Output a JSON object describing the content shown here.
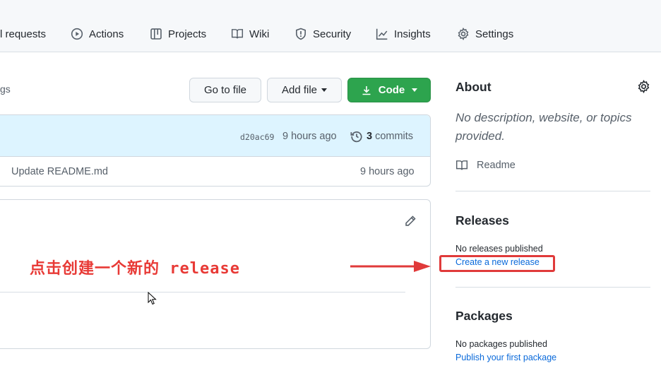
{
  "nav": {
    "items": [
      {
        "label": "l requests",
        "icon": "pull-request-icon"
      },
      {
        "label": "Actions",
        "icon": "play-icon"
      },
      {
        "label": "Projects",
        "icon": "table-icon"
      },
      {
        "label": "Wiki",
        "icon": "book-icon"
      },
      {
        "label": "Security",
        "icon": "shield-icon"
      },
      {
        "label": "Insights",
        "icon": "graph-icon"
      },
      {
        "label": "Settings",
        "icon": "gear-icon"
      }
    ]
  },
  "repo": {
    "tags_fragment": "gs",
    "goto_file_label": "Go to file",
    "add_file_label": "Add file",
    "code_label": "Code",
    "latest_commit": {
      "hash": "d20ac69",
      "time": "9 hours ago",
      "commits_count": "3",
      "commits_label": "commits"
    },
    "files": [
      {
        "message": "Update README.md",
        "time": "9 hours ago"
      }
    ]
  },
  "annotation": {
    "text": "点击创建一个新的 release"
  },
  "sidebar": {
    "about_title": "About",
    "about_description": "No description, website, or topics provided.",
    "readme_label": "Readme",
    "releases_title": "Releases",
    "releases_empty": "No releases published",
    "create_release_link": "Create a new release",
    "packages_title": "Packages",
    "packages_empty": "No packages published",
    "publish_package_link": "Publish your first package"
  },
  "colors": {
    "accent_green": "#2da44e",
    "link_blue": "#0969da",
    "annotation_red": "#e83a36"
  }
}
